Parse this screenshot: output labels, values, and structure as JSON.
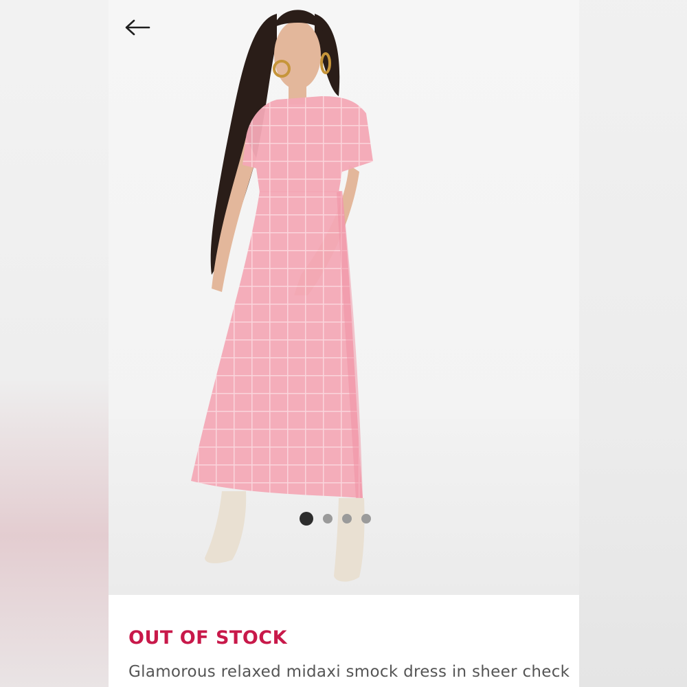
{
  "navigation": {
    "back_icon": "arrow-left-icon"
  },
  "gallery": {
    "image_count": 4,
    "active_index": 0,
    "dress_color": "#f4a8b6"
  },
  "product": {
    "stock_status": "OUT OF STOCK",
    "name": "Glamorous relaxed midaxi smock dress in sheer check"
  },
  "colors": {
    "stock_status": "#c8194a",
    "active_dot": "#2d2d2d",
    "inactive_dot": "#9a9a9a"
  }
}
